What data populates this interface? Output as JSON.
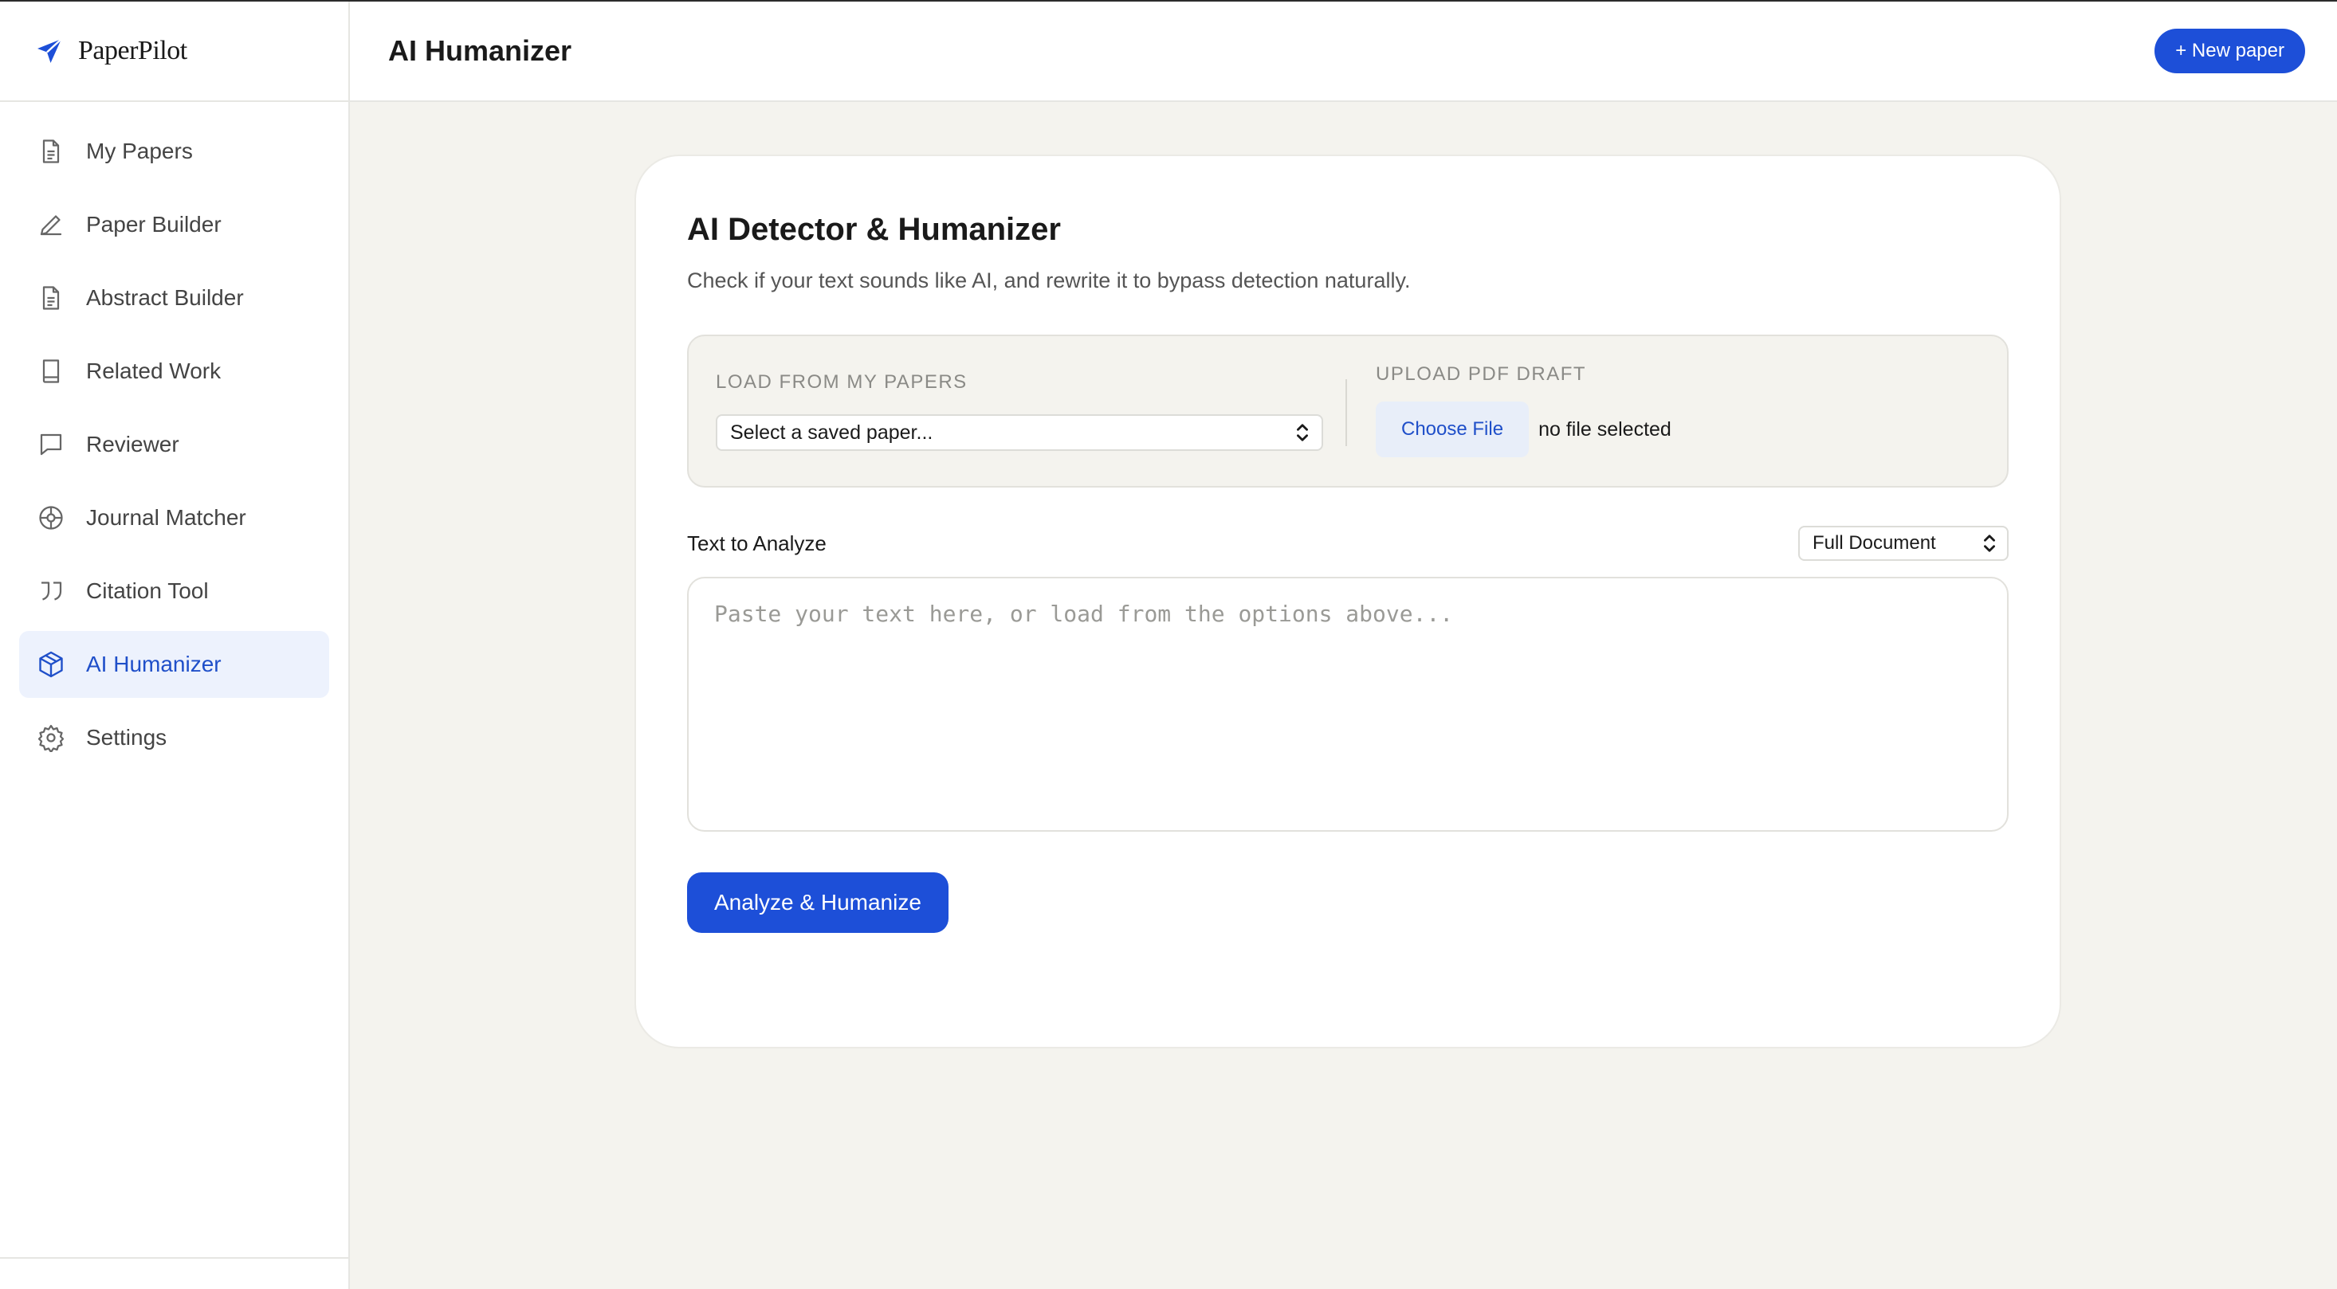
{
  "brand": {
    "name": "PaperPilot",
    "icon": "paper-plane-icon",
    "accent": "#1d4fd8"
  },
  "sidebar": {
    "items": [
      {
        "label": "My Papers",
        "icon": "document-icon",
        "active": false
      },
      {
        "label": "Paper Builder",
        "icon": "pen-icon",
        "active": false
      },
      {
        "label": "Abstract Builder",
        "icon": "document-icon",
        "active": false
      },
      {
        "label": "Related Work",
        "icon": "book-icon",
        "active": false
      },
      {
        "label": "Reviewer",
        "icon": "chat-bubble-icon",
        "active": false
      },
      {
        "label": "Journal Matcher",
        "icon": "target-icon",
        "active": false
      },
      {
        "label": "Citation Tool",
        "icon": "quote-icon",
        "active": false
      },
      {
        "label": "AI Humanizer",
        "icon": "cube-icon",
        "active": true
      },
      {
        "label": "Settings",
        "icon": "gear-icon",
        "active": false
      }
    ]
  },
  "header": {
    "title": "AI Humanizer",
    "new_paper_label": "+ New paper"
  },
  "card": {
    "title": "AI Detector & Humanizer",
    "subtitle": "Check if your text sounds like AI, and rewrite it to bypass detection naturally.",
    "load_label": "LOAD FROM MY PAPERS",
    "saved_paper_select": "Select a saved paper...",
    "upload_label": "UPLOAD PDF DRAFT",
    "choose_file_label": "Choose File",
    "file_status": "no file selected",
    "text_label": "Text to Analyze",
    "scope_select": "Full Document",
    "textarea_placeholder": "Paste your text here, or load from the options above...",
    "textarea_value": "",
    "analyze_label": "Analyze & Humanize"
  }
}
